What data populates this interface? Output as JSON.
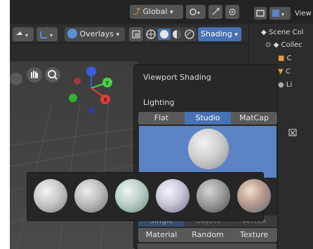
{
  "header": {
    "transform_orientation": "Global",
    "overlays_label": "Overlays",
    "shading_label": "Shading",
    "view_label": "View"
  },
  "outliner": {
    "items": [
      {
        "label": "Scene Col"
      },
      {
        "label": "Collec"
      },
      {
        "label": "C"
      },
      {
        "label": "C"
      },
      {
        "label": "Li"
      }
    ]
  },
  "popup": {
    "title": "Viewport Shading",
    "lighting_label": "Lighting",
    "lighting_options": [
      "Flat",
      "Studio",
      "MatCap"
    ],
    "active_lighting": "Studio",
    "color_options": [
      "Material",
      "Random",
      "Texture"
    ],
    "hidden_options": [
      "Single",
      "Object",
      "Vertex"
    ]
  },
  "matcaps": [
    {
      "name": "matcap-1",
      "color": "#c8c8c8"
    },
    {
      "name": "matcap-2",
      "color": "#bdbdbd"
    },
    {
      "name": "matcap-3",
      "color": "#b9cfc6"
    },
    {
      "name": "matcap-4",
      "color": "#c7c7d8"
    },
    {
      "name": "matcap-5",
      "color": "#9c9c9c"
    },
    {
      "name": "matcap-6",
      "color": "#b79a8a"
    }
  ],
  "colors": {
    "accent_blue": "#4772b3",
    "preview_bg": "#5b83c5",
    "axis_x": "#e53b3b",
    "axis_y": "#4bd04b",
    "axis_z": "#3a5bdb"
  }
}
